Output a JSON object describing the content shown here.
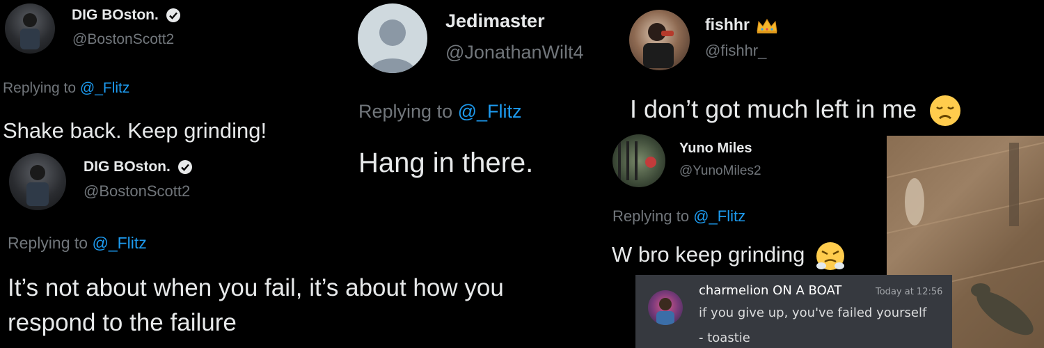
{
  "tweets": [
    {
      "name": "DIG BOston.",
      "handle": "@BostonScott2",
      "verified": true,
      "replying_prefix": "Replying to ",
      "replying_to": "@_Flitz",
      "text": "Shake back. Keep grinding!",
      "avatar_icon": "profile-photo"
    },
    {
      "name": "DIG BOston.",
      "handle": "@BostonScott2",
      "verified": true,
      "replying_prefix": "Replying to ",
      "replying_to": "@_Flitz",
      "text_line1": "It’s not about when you fail, it’s about how you",
      "text_line2": "respond to the failure",
      "avatar_icon": "profile-photo"
    },
    {
      "name": "Jedimaster",
      "handle": "@JonathanWilt4",
      "replying_prefix": "Replying to ",
      "replying_to": "@_Flitz",
      "text": "Hang in there.",
      "avatar_icon": "default-avatar-icon"
    },
    {
      "name": "fishhr",
      "name_emoji": "crown-icon",
      "handle": "@fishhr_",
      "text": "I don’t got much left in me",
      "text_emoji": "disappointed-face-icon",
      "avatar_icon": "profile-photo"
    },
    {
      "name": "Yuno Miles",
      "handle": "@YunoMiles2",
      "replying_prefix": "Replying to ",
      "replying_to": "@_Flitz",
      "text": "W bro keep grinding",
      "text_emoji": "triumph-face-icon",
      "avatar_icon": "profile-photo"
    }
  ],
  "discord_message": {
    "author": "charmelion ON A BOAT",
    "timestamp": "Today at 12:56",
    "line1": "if you give up, you've failed yourself",
    "line2": "- toastie",
    "avatar_icon": "profile-photo"
  },
  "colors": {
    "background": "#000000",
    "text": "#e7e9ea",
    "secondary": "#71767b",
    "mention": "#1d9bf0",
    "verified": "#e7e9ea",
    "discord_bg": "#36393f"
  }
}
